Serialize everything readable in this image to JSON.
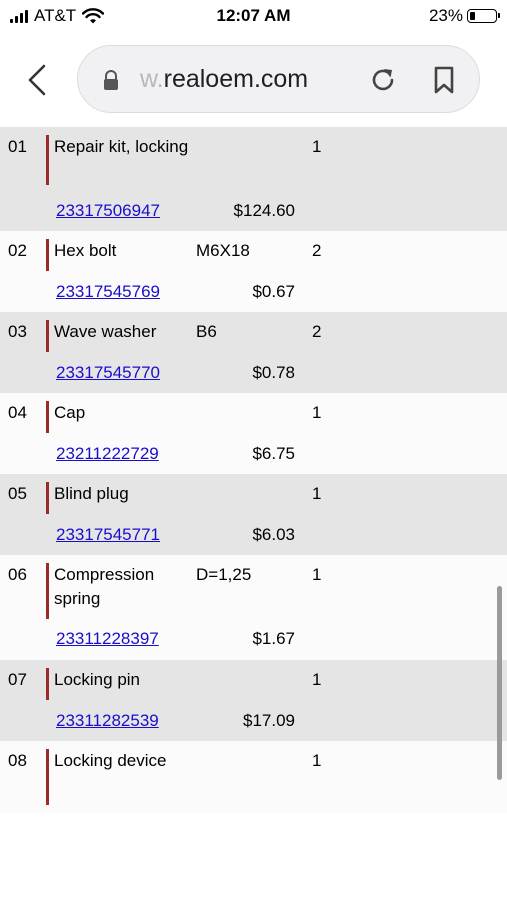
{
  "status_bar": {
    "carrier": "AT&T",
    "time": "12:07 AM",
    "battery_text": "23%"
  },
  "browser": {
    "url_faded_prefix": "w.",
    "url_text": "realoem.com"
  },
  "parts": [
    {
      "num": "01",
      "description": "Repair kit, locking",
      "spec": "",
      "qty": "1",
      "part_number": "23317506947",
      "price": "$124.60"
    },
    {
      "num": "02",
      "description": "Hex bolt",
      "spec": "M6X18",
      "qty": "2",
      "part_number": "23317545769",
      "price": "$0.67"
    },
    {
      "num": "03",
      "description": "Wave washer",
      "spec": "B6",
      "qty": "2",
      "part_number": "23317545770",
      "price": "$0.78"
    },
    {
      "num": "04",
      "description": "Cap",
      "spec": "",
      "qty": "1",
      "part_number": "23211222729",
      "price": "$6.75"
    },
    {
      "num": "05",
      "description": "Blind plug",
      "spec": "",
      "qty": "1",
      "part_number": "23317545771",
      "price": "$6.03"
    },
    {
      "num": "06",
      "description": "Compression spring",
      "spec": "D=1,25",
      "qty": "1",
      "part_number": "23311228397",
      "price": "$1.67"
    },
    {
      "num": "07",
      "description": "Locking pin",
      "spec": "",
      "qty": "1",
      "part_number": "23311282539",
      "price": "$17.09"
    },
    {
      "num": "08",
      "description": "Locking device",
      "spec": "",
      "qty": "1",
      "part_number": "",
      "price": ""
    }
  ]
}
